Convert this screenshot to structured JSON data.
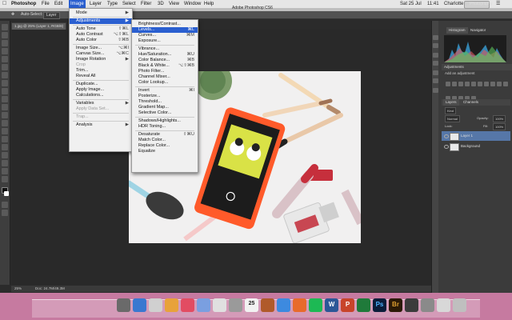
{
  "menubar": {
    "app_name": "Photoshop",
    "items": [
      "File",
      "Edit",
      "Image",
      "Layer",
      "Type",
      "Select",
      "Filter",
      "3D",
      "View",
      "Window",
      "Help"
    ],
    "active_item": "Image",
    "window_title": "Adobe Photoshop CS6",
    "clock": "Sat 25 Jul",
    "time": "11:41",
    "user": "Charlotte Roberts",
    "workspace": "Photography"
  },
  "options_bar": {
    "auto_select": "Auto-Select:",
    "auto_select_value": "Layer"
  },
  "document_tab": "1.jpg @ 25% (Layer 1, RGB/8)",
  "status_bar": {
    "zoom": "25%",
    "doc_size": "Doc: 24.7M/49.3M"
  },
  "image_menu": {
    "items": [
      {
        "label": "Mode",
        "shortcut": "▶",
        "state": "normal"
      },
      {
        "sep": true
      },
      {
        "label": "Adjustments",
        "shortcut": "▶",
        "state": "highlight"
      },
      {
        "sep": true
      },
      {
        "label": "Auto Tone",
        "shortcut": "⇧⌘L",
        "state": "normal"
      },
      {
        "label": "Auto Contrast",
        "shortcut": "⌥⇧⌘L",
        "state": "normal"
      },
      {
        "label": "Auto Color",
        "shortcut": "⇧⌘B",
        "state": "normal"
      },
      {
        "sep": true
      },
      {
        "label": "Image Size...",
        "shortcut": "⌥⌘I",
        "state": "normal"
      },
      {
        "label": "Canvas Size...",
        "shortcut": "⌥⌘C",
        "state": "normal"
      },
      {
        "label": "Image Rotation",
        "shortcut": "▶",
        "state": "normal"
      },
      {
        "label": "Crop",
        "shortcut": "",
        "state": "disabled"
      },
      {
        "label": "Trim...",
        "shortcut": "",
        "state": "normal"
      },
      {
        "label": "Reveal All",
        "shortcut": "",
        "state": "normal"
      },
      {
        "sep": true
      },
      {
        "label": "Duplicate...",
        "shortcut": "",
        "state": "normal"
      },
      {
        "label": "Apply Image...",
        "shortcut": "",
        "state": "normal"
      },
      {
        "label": "Calculations...",
        "shortcut": "",
        "state": "normal"
      },
      {
        "sep": true
      },
      {
        "label": "Variables",
        "shortcut": "▶",
        "state": "normal"
      },
      {
        "label": "Apply Data Set...",
        "shortcut": "",
        "state": "disabled"
      },
      {
        "sep": true
      },
      {
        "label": "Trap...",
        "shortcut": "",
        "state": "disabled"
      },
      {
        "sep": true
      },
      {
        "label": "Analysis",
        "shortcut": "▶",
        "state": "normal"
      }
    ]
  },
  "adjustments_menu": {
    "items": [
      {
        "label": "Brightness/Contrast...",
        "shortcut": "",
        "state": "normal"
      },
      {
        "label": "Levels...",
        "shortcut": "⌘L",
        "state": "highlight"
      },
      {
        "label": "Curves...",
        "shortcut": "⌘M",
        "state": "normal"
      },
      {
        "label": "Exposure...",
        "shortcut": "",
        "state": "normal"
      },
      {
        "sep": true
      },
      {
        "label": "Vibrance...",
        "shortcut": "",
        "state": "normal"
      },
      {
        "label": "Hue/Saturation...",
        "shortcut": "⌘U",
        "state": "normal"
      },
      {
        "label": "Color Balance...",
        "shortcut": "⌘B",
        "state": "normal"
      },
      {
        "label": "Black & White...",
        "shortcut": "⌥⇧⌘B",
        "state": "normal"
      },
      {
        "label": "Photo Filter...",
        "shortcut": "",
        "state": "normal"
      },
      {
        "label": "Channel Mixer...",
        "shortcut": "",
        "state": "normal"
      },
      {
        "label": "Color Lookup...",
        "shortcut": "",
        "state": "normal"
      },
      {
        "sep": true
      },
      {
        "label": "Invert",
        "shortcut": "⌘I",
        "state": "normal"
      },
      {
        "label": "Posterize...",
        "shortcut": "",
        "state": "normal"
      },
      {
        "label": "Threshold...",
        "shortcut": "",
        "state": "normal"
      },
      {
        "label": "Gradient Map...",
        "shortcut": "",
        "state": "normal"
      },
      {
        "label": "Selective Color...",
        "shortcut": "",
        "state": "normal"
      },
      {
        "sep": true
      },
      {
        "label": "Shadows/Highlights...",
        "shortcut": "",
        "state": "normal"
      },
      {
        "label": "HDR Toning...",
        "shortcut": "",
        "state": "normal"
      },
      {
        "sep": true
      },
      {
        "label": "Desaturate",
        "shortcut": "⇧⌘U",
        "state": "normal"
      },
      {
        "label": "Match Color...",
        "shortcut": "",
        "state": "normal"
      },
      {
        "label": "Replace Color...",
        "shortcut": "",
        "state": "normal"
      },
      {
        "label": "Equalize",
        "shortcut": "",
        "state": "normal"
      }
    ]
  },
  "panels": {
    "histogram_tab": "Histogram",
    "navigator_tab": "Navigator",
    "adjustments_title": "Adjustments",
    "adjustments_sub": "Add an adjustment",
    "layers_tab": "Layers",
    "channels_tab": "Channels",
    "kind": "Kind",
    "blend_mode": "Normal",
    "opacity_label": "Opacity:",
    "opacity_value": "100%",
    "lock_label": "Lock:",
    "fill_label": "Fill:",
    "fill_value": "100%",
    "layers": [
      "Layer 1",
      "Background"
    ]
  },
  "colors": {
    "menu_highlight": "#2a5fd0",
    "dock_background": "#c67aa0"
  },
  "dock_labels": [
    "25",
    "Ps",
    "Br",
    "W",
    "P"
  ]
}
